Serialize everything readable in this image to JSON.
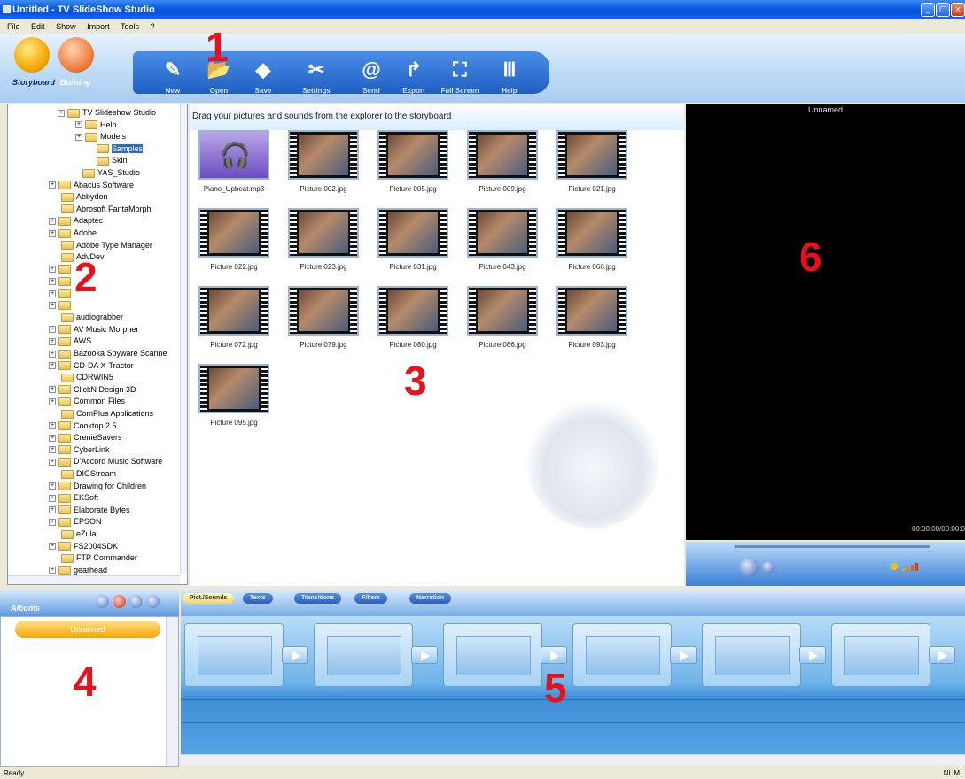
{
  "window": {
    "title": "Untitled - TV SlideShow Studio"
  },
  "menu": [
    "File",
    "Edit",
    "Show",
    "Import",
    "Tools",
    "?"
  ],
  "modes": {
    "storyboard": "Storyboard",
    "burning": "Burning"
  },
  "toolbar": {
    "new": "New",
    "open": "Open",
    "save": "Save",
    "settings": "Settings",
    "send": "Send",
    "export": "Export",
    "full_screen": "Full Screen",
    "help": "Help"
  },
  "callouts": {
    "n1": "1",
    "n2": "2",
    "n3": "3",
    "n4": "4",
    "n5": "5",
    "n6": "6"
  },
  "tree": [
    "TV Slideshow Studio",
    "Help",
    "Models",
    "Samples",
    "Skin",
    "YAS_Studio",
    "Abacus Software",
    "Abbydon",
    "Abrosoft FantaMorph",
    "Adaptec",
    "Adobe",
    "Adobe Type Manager",
    "AdvDev",
    "",
    "",
    "",
    "",
    "audiograbber",
    "AV Music Morpher",
    "AWS",
    "Bazooka Spyware Scanne",
    "CD-DA X-Tractor",
    "CDRWIN5",
    "ClickN Design 3D",
    "Common Files",
    "ComPlus Applications",
    "Cooktop 2.5",
    "CrenieSavers",
    "CyberLink",
    "D'Accord Music Software",
    "DIGStream",
    "Drawing for Children",
    "EKSoft",
    "Elaborate Bytes",
    "EPSON",
    "eZula",
    "FS2004SDK",
    "FTP Commander",
    "gearhead"
  ],
  "explorer": {
    "header": "Drag your pictures and sounds from the explorer to the storyboard",
    "items": [
      "Piano_Upbeat.mp3",
      "Picture 002.jpg",
      "Picture 005.jpg",
      "Picture 009.jpg",
      "Picture 021.jpg",
      "Picture 022.jpg",
      "Picture 023.jpg",
      "Picture 031.jpg",
      "Picture 043.jpg",
      "Picture 066.jpg",
      "Picture 072.jpg",
      "Picture 079.jpg",
      "Picture 080.jpg",
      "Picture 086.jpg",
      "Picture 093.jpg",
      "Picture 095.jpg"
    ]
  },
  "preview": {
    "title": "Unnamed",
    "time": "00:00:00/00:00:0"
  },
  "albums": {
    "label": "Albums",
    "items": [
      "Unnamed"
    ]
  },
  "story_tabs": [
    "Pict./Sounds",
    "Texts",
    "Transitions",
    "Filters",
    "Narration"
  ],
  "status": {
    "left": "Ready",
    "right": "NUM"
  }
}
